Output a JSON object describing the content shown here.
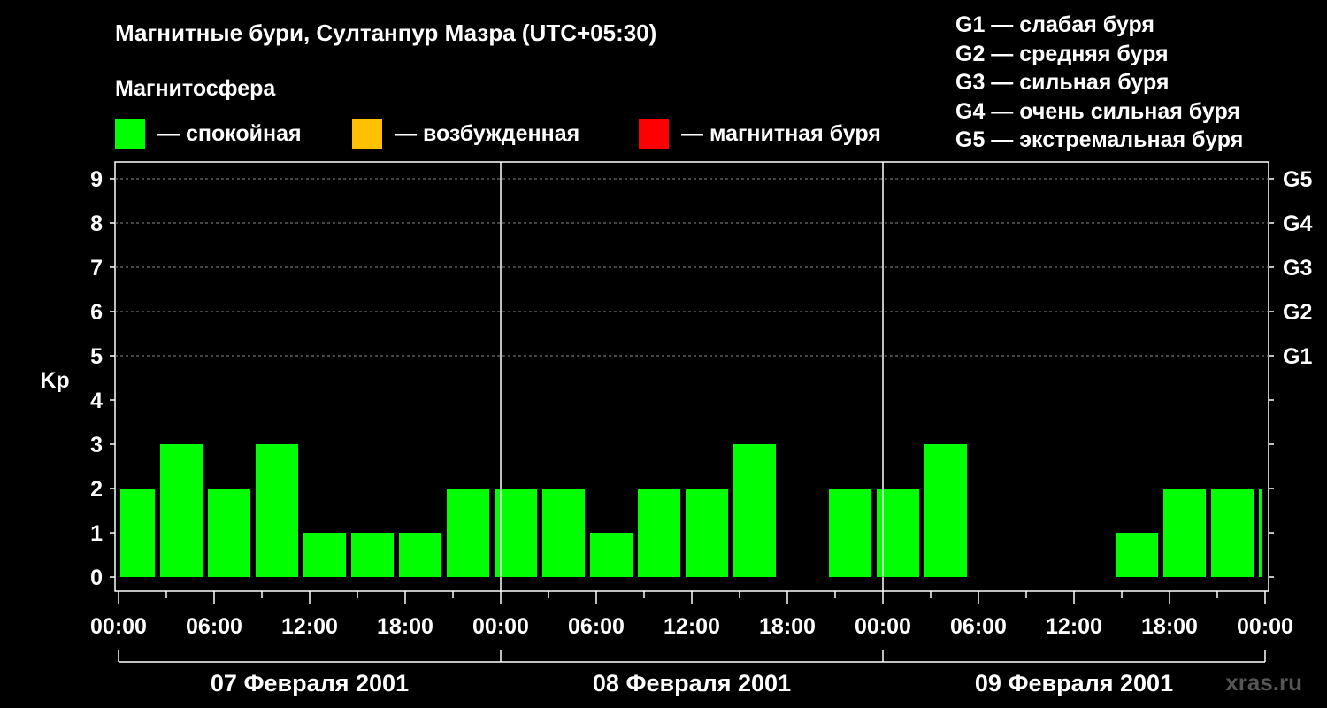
{
  "header": {
    "title": "Магнитные бури, Султанпур Мазра (UTC+05:30)",
    "subtitle": "Магнитосфера"
  },
  "legend": {
    "items": [
      {
        "label": "— спокойная",
        "color": "#00ff00"
      },
      {
        "label": "— возбужденная",
        "color": "#ffc000"
      },
      {
        "label": "— магнитная буря",
        "color": "#ff0000"
      }
    ]
  },
  "g_legend": [
    "G1 — слабая буря",
    "G2 — средняя буря",
    "G3 — сильная буря",
    "G4 — очень сильная буря",
    "G5 — экстремальная буря"
  ],
  "watermark": "xras.ru",
  "chart_data": {
    "type": "bar",
    "ylabel": "Kp",
    "ylim": [
      0,
      9
    ],
    "yticks": [
      0,
      1,
      2,
      3,
      4,
      5,
      6,
      7,
      8,
      9
    ],
    "g_levels": [
      {
        "label": "G1",
        "kp": 5
      },
      {
        "label": "G2",
        "kp": 6
      },
      {
        "label": "G3",
        "kp": 7
      },
      {
        "label": "G4",
        "kp": 8
      },
      {
        "label": "G5",
        "kp": 9
      }
    ],
    "x_tick_labels": [
      "00:00",
      "06:00",
      "12:00",
      "18:00",
      "00:00",
      "06:00",
      "12:00",
      "18:00",
      "00:00",
      "06:00",
      "12:00",
      "18:00",
      "00:00"
    ],
    "days": [
      "07 Февраля 2001",
      "08 Февраля 2001",
      "09 Февраля 2001"
    ],
    "grid": "dashed horizontal at G levels",
    "bar_color": "#00ff00",
    "series": [
      {
        "values": [
          {
            "start": "07 Февраля 2001 00:00",
            "end": "07 Февраля 2001 02:30",
            "kp": 2
          },
          {
            "start": "07 Февраля 2001 02:30",
            "end": "07 Февраля 2001 05:30",
            "kp": 3
          },
          {
            "start": "07 Февраля 2001 05:30",
            "end": "07 Февраля 2001 08:30",
            "kp": 2
          },
          {
            "start": "07 Февраля 2001 08:30",
            "end": "07 Февраля 2001 11:30",
            "kp": 3
          },
          {
            "start": "07 Февраля 2001 11:30",
            "end": "07 Февраля 2001 14:30",
            "kp": 1
          },
          {
            "start": "07 Февраля 2001 14:30",
            "end": "07 Февраля 2001 17:30",
            "kp": 1
          },
          {
            "start": "07 Февраля 2001 17:30",
            "end": "07 Февраля 2001 20:30",
            "kp": 1
          },
          {
            "start": "07 Февраля 2001 20:30",
            "end": "07 Февраля 2001 23:30",
            "kp": 2
          },
          {
            "start": "07 Февраля 2001 23:30",
            "end": "08 Февраля 2001 02:30",
            "kp": 2
          },
          {
            "start": "08 Февраля 2001 02:30",
            "end": "08 Февраля 2001 05:30",
            "kp": 2
          },
          {
            "start": "08 Февраля 2001 05:30",
            "end": "08 Февраля 2001 08:30",
            "kp": 1
          },
          {
            "start": "08 Февраля 2001 08:30",
            "end": "08 Февраля 2001 11:30",
            "kp": 2
          },
          {
            "start": "08 Февраля 2001 11:30",
            "end": "08 Февраля 2001 14:30",
            "kp": 2
          },
          {
            "start": "08 Февраля 2001 14:30",
            "end": "08 Февраля 2001 17:30",
            "kp": 3
          },
          {
            "start": "08 Февраля 2001 17:30",
            "end": "08 Февраля 2001 20:30",
            "kp": 0
          },
          {
            "start": "08 Февраля 2001 20:30",
            "end": "08 Февраля 2001 23:30",
            "kp": 2
          },
          {
            "start": "08 Февраля 2001 23:30",
            "end": "09 Февраля 2001 02:30",
            "kp": 2
          },
          {
            "start": "09 Февраля 2001 02:30",
            "end": "09 Февраля 2001 05:30",
            "kp": 3
          },
          {
            "start": "09 Февраля 2001 05:30",
            "end": "09 Февраля 2001 08:30",
            "kp": 0
          },
          {
            "start": "09 Февраля 2001 08:30",
            "end": "09 Февраля 2001 11:30",
            "kp": 0
          },
          {
            "start": "09 Февраля 2001 11:30",
            "end": "09 Февраля 2001 14:30",
            "kp": 0
          },
          {
            "start": "09 Февраля 2001 14:30",
            "end": "09 Февраля 2001 17:30",
            "kp": 1
          },
          {
            "start": "09 Февраля 2001 17:30",
            "end": "09 Февраля 2001 20:30",
            "kp": 2
          },
          {
            "start": "09 Февраля 2001 20:30",
            "end": "09 Февраля 2001 23:30",
            "kp": 2
          },
          {
            "start": "09 Февраля 2001 23:30",
            "end": "10 Февраля 2001 00:00",
            "kp": 2
          }
        ]
      }
    ]
  }
}
